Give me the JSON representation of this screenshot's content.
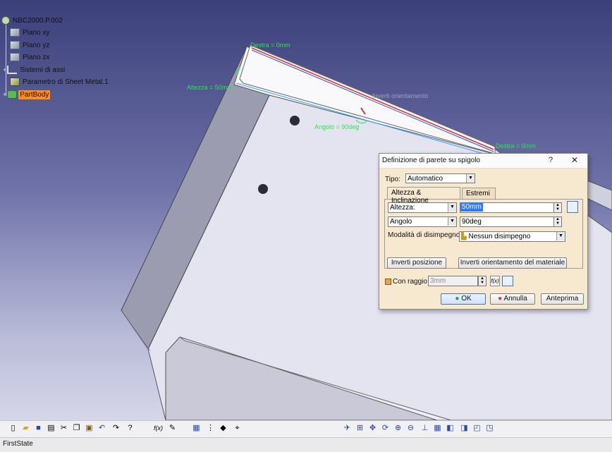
{
  "tree": {
    "root": "NBC2000.P.002",
    "items": [
      "Piano xy",
      "Piano yz",
      "Piano zx",
      "Sistemi di assi",
      "Parametro di Sheet Metal.1",
      "PartBody"
    ]
  },
  "annotations": {
    "destra_top": "Destra = 0mm",
    "altezza": "Altezza = 50mm",
    "angolo": "Angolo = 90deg",
    "destra_right": "Destra = 0mm",
    "grey_label": "Inverti orientamento"
  },
  "dialog": {
    "title": "Definizione di parete su spigolo",
    "help": "?",
    "close": "✕",
    "tipo_label": "Tipo:",
    "tipo_value": "Automatico",
    "tabs": [
      "Altezza & Inclinazione",
      "Estremi"
    ],
    "altezza_type": "Altezza:",
    "altezza_value": "50mm",
    "angolo_type": "Angolo",
    "angolo_value": "90deg",
    "modalita_label": "Modalità di disimpegno:",
    "modalita_value": "Nessun disimpegno",
    "btn_inverti_posizione": "Inverti posizione",
    "btn_inverti_orientamento": "Inverti orientamento del materiale",
    "con_raggio_label": "Con raggio",
    "raggio_value": "3mm",
    "ok": "OK",
    "annulla": "Annulla",
    "anteprima": "Anteprima"
  },
  "status": {
    "text": "FirstState"
  },
  "colors": {
    "background_top": "#3b3f7a",
    "background_bottom": "#d6d7e8",
    "highlight": "#ff8c1a",
    "annotation": "#26e84a",
    "dialog_bg": "#f7e9cf"
  }
}
